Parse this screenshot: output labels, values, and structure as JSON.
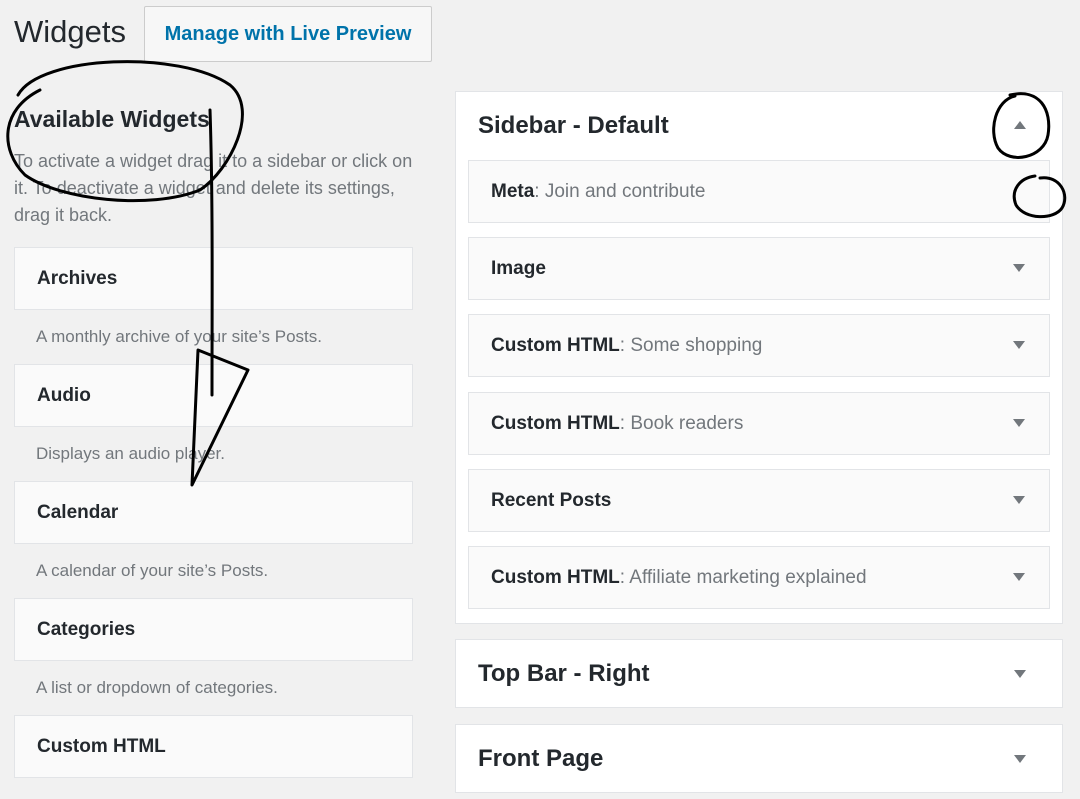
{
  "header": {
    "title": "Widgets",
    "live_preview_label": "Manage with Live Preview"
  },
  "available": {
    "title": "Available Widgets",
    "description": "To activate a widget drag it to a sidebar or click on it. To deactivate a widget and delete its settings, drag it back.",
    "widgets": [
      {
        "name": "Archives",
        "description": "A monthly archive of your site’s Posts."
      },
      {
        "name": "Audio",
        "description": "Displays an audio player."
      },
      {
        "name": "Calendar",
        "description": "A calendar of your site’s Posts."
      },
      {
        "name": "Categories",
        "description": "A list or dropdown of categories."
      },
      {
        "name": "Custom HTML",
        "description": ""
      }
    ]
  },
  "sidebars": [
    {
      "title": "Sidebar - Default",
      "expanded": true,
      "widgets": [
        {
          "name": "Meta",
          "subtitle": ": Join and contribute"
        },
        {
          "name": "Image",
          "subtitle": ""
        },
        {
          "name": "Custom HTML",
          "subtitle": ": Some shopping"
        },
        {
          "name": "Custom HTML",
          "subtitle": ": Book readers"
        },
        {
          "name": "Recent Posts",
          "subtitle": ""
        },
        {
          "name": "Custom HTML",
          "subtitle": ": Affiliate marketing explained"
        }
      ]
    },
    {
      "title": "Top Bar - Right",
      "expanded": false
    },
    {
      "title": "Front Page",
      "expanded": false
    }
  ],
  "icons": {
    "collapse": "triangle-up-icon",
    "expand": "triangle-down-icon"
  },
  "colors": {
    "link": "#0073aa",
    "text": "#23282d",
    "muted": "#72777c",
    "background": "#f1f1f1"
  }
}
